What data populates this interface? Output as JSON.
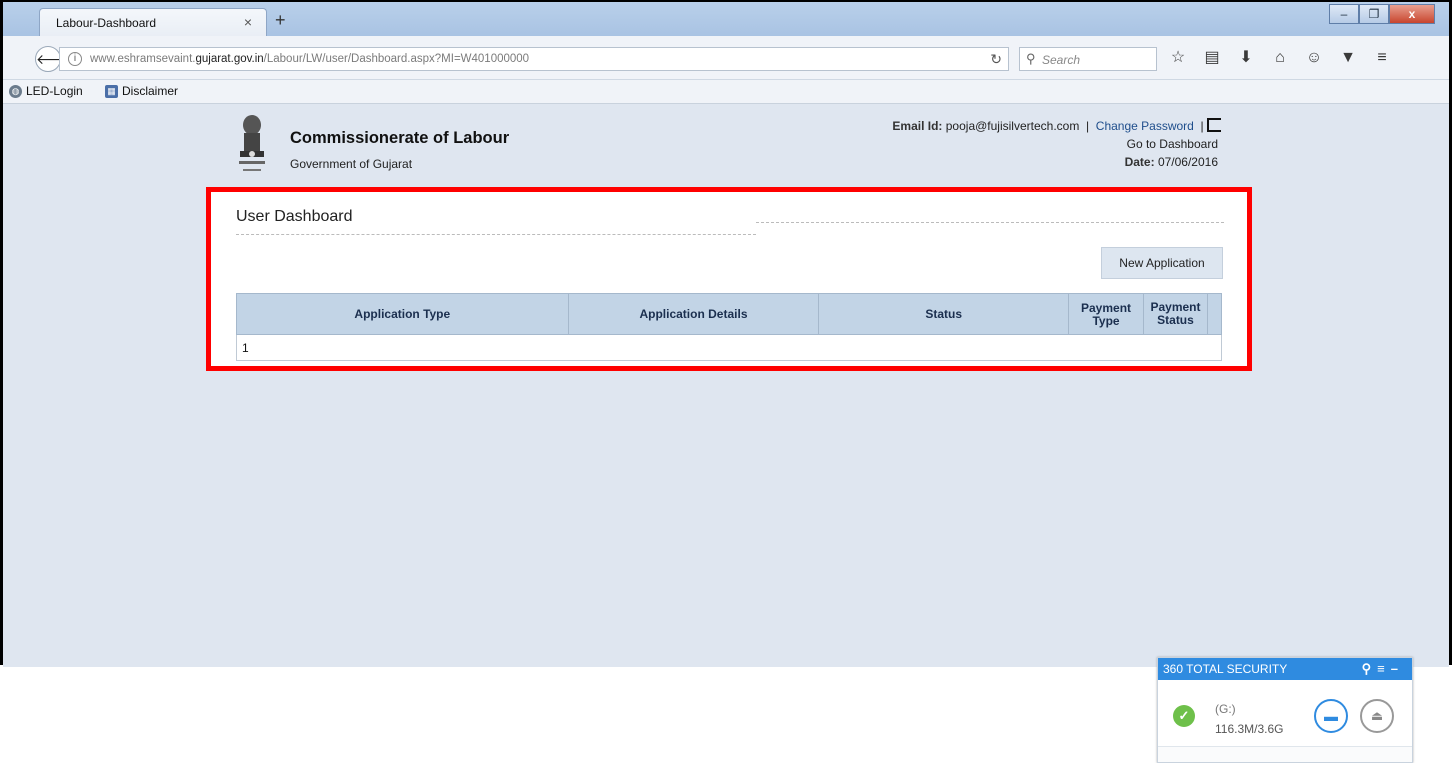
{
  "browser": {
    "tab_title": "Labour-Dashboard",
    "tab_close": "×",
    "new_tab": "+",
    "url_host_prefix": "www.eshramsevaint.",
    "url_host_bold": "gujarat.gov.in",
    "url_path": "/Labour/LW/user/Dashboard.aspx?MI=W401000000",
    "search_placeholder": "Search",
    "bookmarks": [
      {
        "label": "LED-Login"
      },
      {
        "label": "Disclaimer"
      }
    ]
  },
  "header": {
    "org_title": "Commissionerate of Labour",
    "org_subtitle": "Government of Gujarat",
    "email_label": "Email Id:",
    "email_value": "pooja@fujisilvertech.com",
    "separator": "|",
    "change_password": "Change Password",
    "dashboard_link": "Go to Dashboard",
    "date_label": "Date:",
    "date_value": "07/06/2016"
  },
  "panel": {
    "title": "User Dashboard",
    "new_application_button": "New Application",
    "table": {
      "columns": [
        "Application Type",
        "Application Details",
        "Status",
        "Payment Type",
        "Payment Status"
      ],
      "rows": [
        [
          "1",
          "",
          "",
          "",
          ""
        ]
      ]
    }
  },
  "widget_360": {
    "title": "360 TOTAL SECURITY",
    "drive": "(G:)",
    "usage": "116.3M/3.6G"
  },
  "colors": {
    "highlight_border": "#ff0000",
    "table_header_bg": "#c2d4e6",
    "widget_accent": "#2f8be0"
  }
}
